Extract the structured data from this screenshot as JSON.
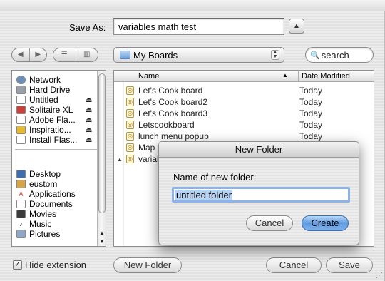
{
  "save_panel": {
    "save_as_label": "Save As:",
    "filename": "variables math test",
    "location": "My Boards",
    "search_placeholder": "search",
    "hide_extension_label": "Hide extension",
    "hide_extension_checked": true,
    "new_folder_label": "New Folder",
    "cancel_label": "Cancel",
    "save_label": "Save"
  },
  "sidebar": {
    "items": [
      {
        "label": "Network",
        "icon": "globe-icon",
        "eject": false
      },
      {
        "label": "Hard Drive",
        "icon": "hard-drive-icon",
        "eject": false
      },
      {
        "label": "Untitled",
        "icon": "disk-icon",
        "eject": true
      },
      {
        "label": "Solitaire XL",
        "icon": "app-disk-icon",
        "eject": true
      },
      {
        "label": "Adobe Fla...",
        "icon": "disk-icon",
        "eject": true
      },
      {
        "label": "Inspiratio...",
        "icon": "app-disk-icon",
        "eject": true
      },
      {
        "label": "Install Flas...",
        "icon": "disk-icon",
        "eject": true
      }
    ],
    "places": [
      {
        "label": "Desktop",
        "icon": "desktop-icon"
      },
      {
        "label": "eustom",
        "icon": "home-icon"
      },
      {
        "label": "Applications",
        "icon": "applications-icon"
      },
      {
        "label": "Documents",
        "icon": "documents-icon"
      },
      {
        "label": "Movies",
        "icon": "movies-icon"
      },
      {
        "label": "Music",
        "icon": "music-icon"
      },
      {
        "label": "Pictures",
        "icon": "pictures-icon"
      }
    ]
  },
  "file_list": {
    "columns": {
      "name": "Name",
      "date": "Date Modified"
    },
    "rows": [
      {
        "name": "Let's Cook board",
        "date": "Today"
      },
      {
        "name": "Let's Cook board2",
        "date": "Today"
      },
      {
        "name": "Let's Cook board3",
        "date": "Today"
      },
      {
        "name": "Letscookboard",
        "date": "Today"
      },
      {
        "name": "lunch menu popup",
        "date": "Today"
      },
      {
        "name": "Map",
        "date": ""
      },
      {
        "name": "varial",
        "date": ""
      }
    ]
  },
  "new_folder_dialog": {
    "title": "New Folder",
    "prompt": "Name of new folder:",
    "value": "untitled folder",
    "cancel_label": "Cancel",
    "create_label": "Create"
  },
  "colors": {
    "accent": "#5f9be0",
    "selection": "#b5d3f5"
  }
}
